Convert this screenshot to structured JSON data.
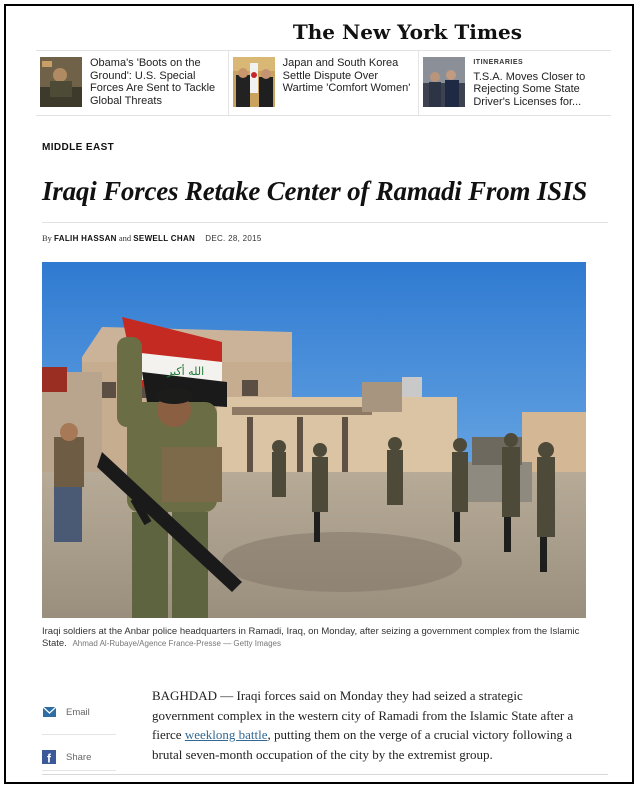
{
  "masthead": {
    "title": "The New York Times"
  },
  "promos": [
    {
      "kicker": "",
      "text": "Obama's 'Boots on the Ground': U.S. Special Forces Are Sent to Tackle Global Threats"
    },
    {
      "kicker": "",
      "text": "Japan and South Korea Settle Dispute Over Wartime 'Comfort Women'"
    },
    {
      "kicker": "ITINERARIES",
      "text": "T.S.A. Moves Closer to Rejecting Some State Driver's Licenses for..."
    }
  ],
  "article": {
    "section": "MIDDLE EAST",
    "headline": "Iraqi Forces Retake Center of Ramadi From ISIS",
    "by": "By",
    "author1": "FALIH HASSAN",
    "and": "and",
    "author2": "SEWELL CHAN",
    "date": "DEC. 28, 2015",
    "caption": "Iraqi soldiers at the Anbar police headquarters in Ramadi, Iraq, on Monday, after seizing a government complex from the Islamic State.",
    "credit": "Ahmad Al-Rubaye/Agence France-Presse — Getty Images",
    "body_before_link": "BAGHDAD — Iraqi forces said on Monday they had seized a strategic government complex in the western city of Ramadi from the Islamic State after a fierce ",
    "body_link": "weeklong battle",
    "body_after_link": ", putting them on the verge of a crucial victory following a brutal seven-month occupation of the city by the extremist group."
  },
  "share": {
    "email_label": "Email",
    "share_label": "Share"
  },
  "colors": {
    "link": "#326891",
    "email_icon": "#2f6ea5",
    "facebook_icon": "#3b5998"
  }
}
